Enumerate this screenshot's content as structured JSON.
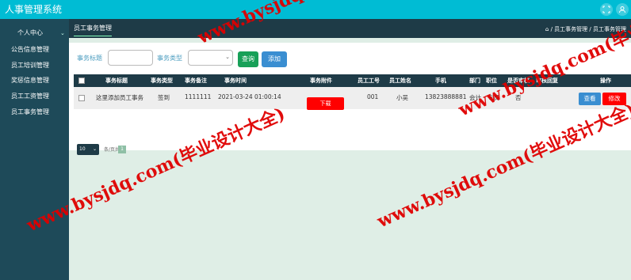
{
  "app": {
    "title": "人事管理系统"
  },
  "sidebar": {
    "items": [
      {
        "label": "个人中心"
      },
      {
        "label": "公告信息管理"
      },
      {
        "label": "员工培训管理"
      },
      {
        "label": "奖惩信息管理"
      },
      {
        "label": "员工工资管理"
      },
      {
        "label": "员工事务管理"
      }
    ]
  },
  "main": {
    "page_title": "员工事务管理",
    "breadcrumb": "/ 员工事务管理 / 员工事务管理"
  },
  "filters": {
    "title_label": "事务标题",
    "type_label": "事务类型",
    "title_value": "",
    "type_value": "",
    "query_label": "查询",
    "add_label": "添加"
  },
  "table": {
    "headers": [
      "事务标题",
      "事务类型",
      "事务备注",
      "事务时间",
      "事务附件",
      "员工工号",
      "员工姓名",
      "手机",
      "部门",
      "职位",
      "是否审核",
      "审核回复",
      "操作"
    ],
    "rows": [
      {
        "title": "这里添加员工事务",
        "type": "签到",
        "note": "1111111",
        "time": "2021-03-24 01:00:14",
        "attachment_button": "下载",
        "emp_no": "001",
        "emp_name": "小吴",
        "phone": "13823888881",
        "dept": "会计",
        "position": "专员",
        "approved": "否",
        "reply": "",
        "view_label": "查看",
        "edit_label": "修改"
      }
    ]
  },
  "pagination": {
    "page_size": "10",
    "per_page_text": "条/页共",
    "current_page": "1"
  },
  "watermark": {
    "text": "www.bysjdq.com(毕业设计大全)"
  },
  "colors": {
    "topbar": "#00bcd4",
    "sidebar": "#1e4a59",
    "header": "#1e3b47",
    "accent_red": "#ff0000",
    "accent_blue": "#3a8ed1",
    "accent_green": "#18a058",
    "watermark": "#e00000"
  }
}
